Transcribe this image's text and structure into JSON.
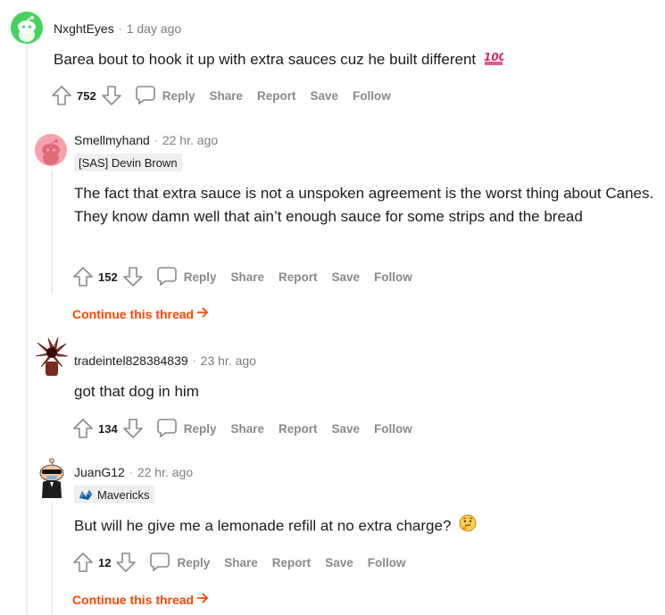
{
  "comments": [
    {
      "author": "NxghtEyes",
      "time": "1 day ago",
      "body": "Barea bout to hook it up with extra sauces cuz he built different",
      "emoji": "100-emoji",
      "votes": "752",
      "avatar_color": "#46d160"
    },
    {
      "author": "Smellmyhand",
      "time": "22 hr. ago",
      "flair": "[SAS] Devin Brown",
      "body": "The fact that extra sauce is not a unspoken agreement is the worst thing about Canes. They know damn well that ain’t enough sauce for some strips and the bread",
      "votes": "152",
      "avatar_color": "#ff585b",
      "continue": "Continue this thread"
    },
    {
      "author": "tradeintel828384839",
      "time": "23 hr. ago",
      "body": "got that dog in him",
      "votes": "134"
    },
    {
      "author": "JuanG12",
      "time": "22 hr. ago",
      "flair": "Mavericks",
      "body": "But will he give me a lemonade refill at no extra charge?",
      "emoji": "thinking-face-emoji",
      "votes": "12",
      "continue": "Continue this thread"
    }
  ],
  "actions": {
    "reply": "Reply",
    "share": "Share",
    "report": "Report",
    "save": "Save",
    "follow": "Follow"
  },
  "separator": "·",
  "colors": {
    "accent": "#ff4500",
    "muted": "#878a8c",
    "thread_line": "#edeff1"
  }
}
